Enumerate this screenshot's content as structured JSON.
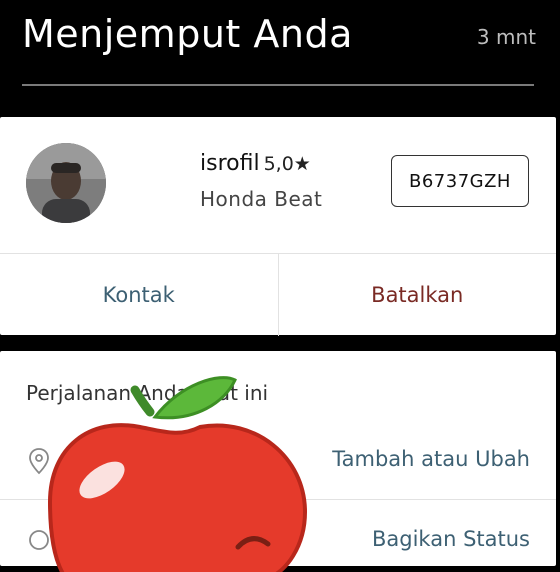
{
  "header": {
    "title": "Menjemput Anda",
    "eta": "3 mnt"
  },
  "driver": {
    "name": "isrofil",
    "rating": "5,0★",
    "vehicle": "Honda Beat",
    "plate": "B6737GZH"
  },
  "actions": {
    "contact_label": "Kontak",
    "cancel_label": "Batalkan"
  },
  "trip": {
    "title": "Perjalanan Anda saat ini",
    "edit_label": "Tambah atau Ubah",
    "share_label": "Bagikan Status"
  },
  "icons": {
    "destination": "map-pin-icon",
    "share": "circle-icon",
    "sticker": "apple-sticker"
  },
  "colors": {
    "header_bg": "#000000",
    "link": "#3d6073",
    "cancel": "#7a2a24",
    "apple_red": "#e53a2b",
    "leaf_green": "#5cb83a"
  }
}
